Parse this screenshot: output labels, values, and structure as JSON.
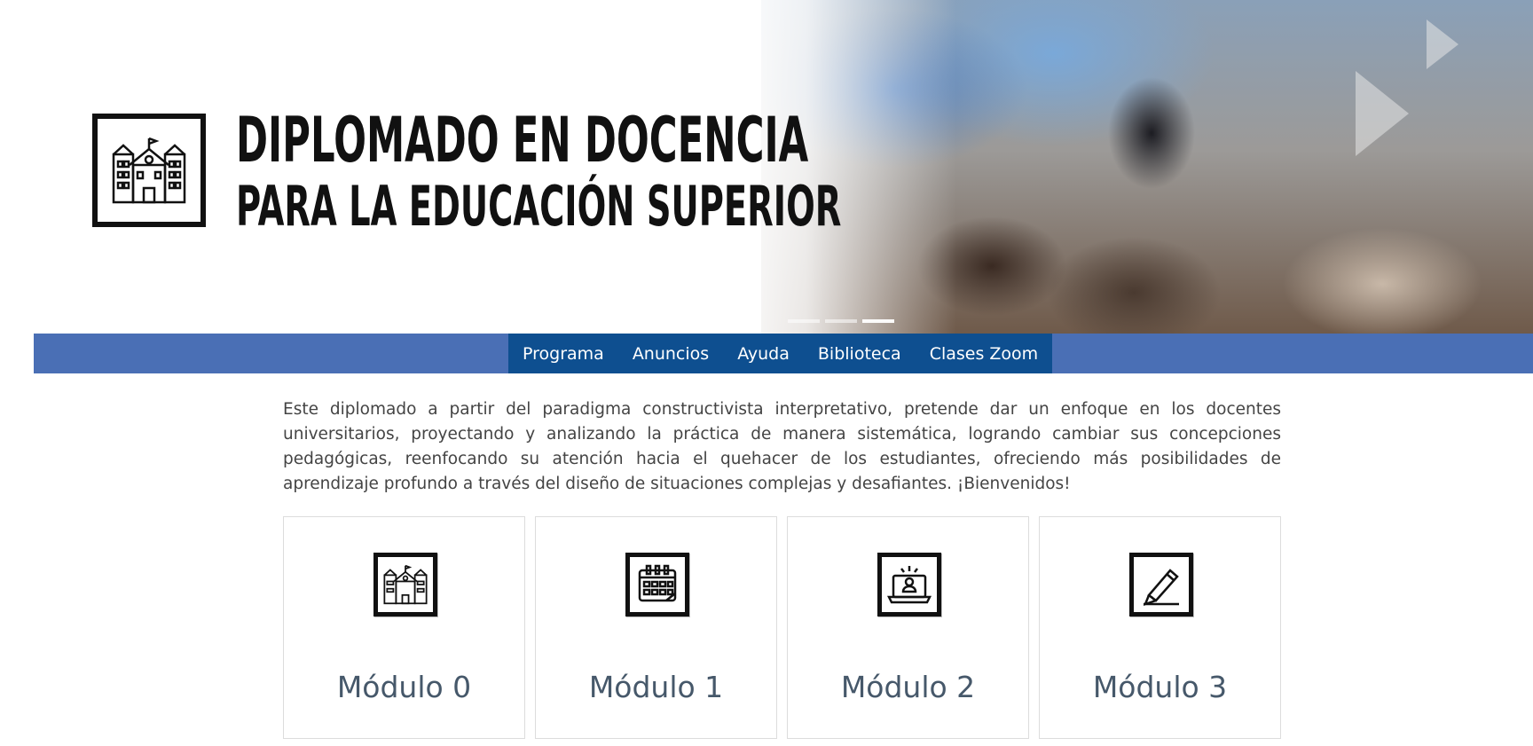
{
  "banner": {
    "title_line1": "DIPLOMADO EN DOCENCIA",
    "title_line2": "PARA LA EDUCACIÓN SUPERIOR",
    "logo_icon": "school-building-icon"
  },
  "nav": {
    "items": [
      "Programa",
      "Anuncios",
      "Ayuda",
      "Biblioteca",
      "Clases Zoom"
    ]
  },
  "intro": {
    "text": "Este diplomado a partir del paradigma constructivista interpretativo, pretende dar un enfoque en los docentes universitarios, proyectando y analizando la práctica de manera sistemática, logrando cambiar sus concepciones pedagógicas, reenfocando su atención hacia el quehacer de los estudiantes, ofreciendo más posibilidades de aprendizaje profundo a través del diseño de situaciones complejas y desafiantes. ¡Bienvenidos!"
  },
  "modules": [
    {
      "title": "Módulo 0",
      "icon": "school-building-icon"
    },
    {
      "title": "Módulo 1",
      "icon": "calendar-icon"
    },
    {
      "title": "Módulo 2",
      "icon": "laptop-idea-icon"
    },
    {
      "title": "Módulo 3",
      "icon": "pencil-icon"
    }
  ],
  "colors": {
    "navbar": "#4a6fb5",
    "navmenu": "#0e4f90",
    "card_title": "#46586a"
  }
}
